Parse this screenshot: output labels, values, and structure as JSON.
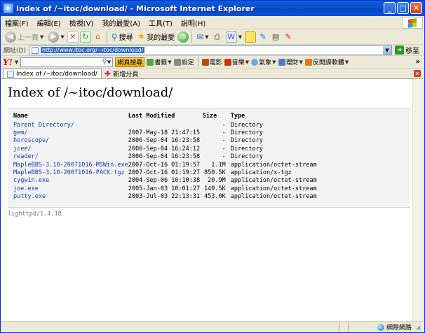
{
  "window": {
    "title": "Index of /~itoc/download/ - Microsoft Internet Explorer",
    "minimize": "_",
    "maximize": "□",
    "close": "✕"
  },
  "menubar": {
    "items": [
      "檔案(F)",
      "編輯(E)",
      "檢視(V)",
      "我的最愛(A)",
      "工具(T)",
      "說明(H)"
    ]
  },
  "toolbar": {
    "back_label": "上一頁",
    "search_label": "搜尋",
    "favorites_label": "我的最愛"
  },
  "address": {
    "label": "網址(D)",
    "url": "http://www.itoc.org/~itoc/download/",
    "go_label": "移至"
  },
  "yahoo": {
    "logo": "Y!",
    "web_search": "網頁搜尋",
    "items": [
      "書籤",
      "設定",
      "電影",
      "音樂",
      "氣象",
      "理財",
      "反間諜軟體"
    ],
    "more": "»"
  },
  "tabs": {
    "active": "Index of /~itoc/download/",
    "new_tab": "新增分頁"
  },
  "page": {
    "heading": "Index of /~itoc/download/",
    "columns": {
      "name": "Name",
      "modified": "Last Modified",
      "size": "Size",
      "type": "Type"
    },
    "rows": [
      {
        "name": "Parent Directory/",
        "modified": "",
        "size": "-",
        "type": "Directory"
      },
      {
        "name": "gem/",
        "modified": "2007-May-18 21:47:15",
        "size": "-",
        "type": "Directory"
      },
      {
        "name": "horoscope/",
        "modified": "2006-Sep-04 16:23:58",
        "size": "-",
        "type": "Directory"
      },
      {
        "name": "jcee/",
        "modified": "2006-Sep-04 16:24:12",
        "size": "-",
        "type": "Directory"
      },
      {
        "name": "reader/",
        "modified": "2006-Sep-04 16:23:58",
        "size": "-",
        "type": "Directory"
      },
      {
        "name": "MapleBBS-3.10-20071016-MSWin.exe",
        "modified": "2007-Oct-16 01:19:57",
        "size": "1.1M",
        "type": "application/octet-stream"
      },
      {
        "name": "MapleBBS-3.10-20071016-PACK.tgz",
        "modified": "2007-Oct-16 01:19:27",
        "size": "850.5K",
        "type": "application/x-tgz"
      },
      {
        "name": "cygwin.exe",
        "modified": "2004-Sep-06 10:10:38",
        "size": "20.9M",
        "type": "application/octet-stream"
      },
      {
        "name": "joe.exe",
        "modified": "2005-Jan-03 10:01:27",
        "size": "149.5K",
        "type": "application/octet-stream"
      },
      {
        "name": "putty.exe",
        "modified": "2003-Jul-03 22:13:31",
        "size": "453.0K",
        "type": "application/octet-stream"
      }
    ],
    "footer": "lighttpd/1.4.18"
  },
  "status": {
    "zone": "網際網路"
  },
  "colors": {
    "title_blue": "#0a52d6",
    "link_blue": "#1a3aa6",
    "chrome": "#ece9d8"
  }
}
